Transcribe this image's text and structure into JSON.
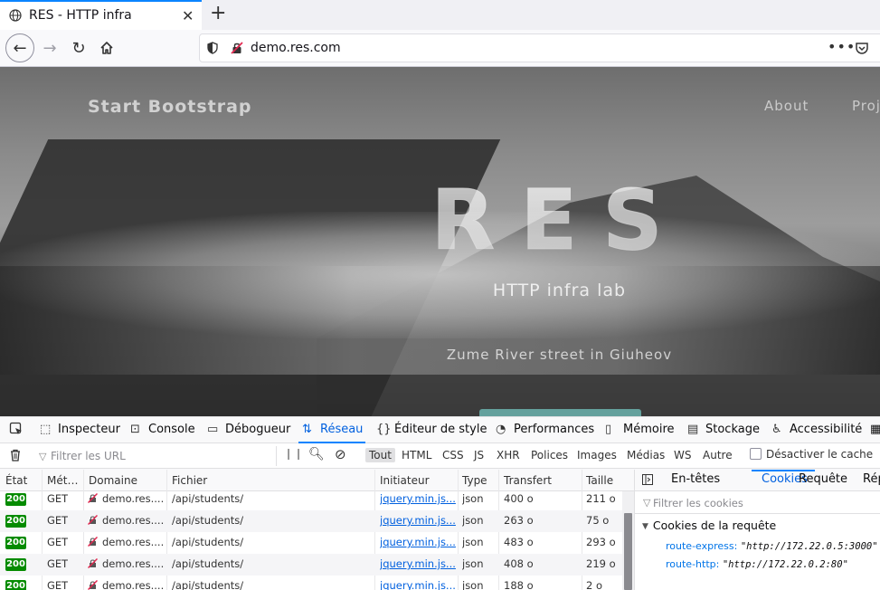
{
  "browser": {
    "tab_title": "RES - HTTP infra",
    "url": "demo.res.com"
  },
  "page": {
    "brand": "Start Bootstrap",
    "nav": [
      "About",
      "Proj"
    ],
    "title": "RES",
    "subtitle": "HTTP infra lab",
    "address": "Zume River street in Giuheov"
  },
  "devtools": {
    "tabs": [
      "Inspecteur",
      "Console",
      "Débogueur",
      "Réseau",
      "Éditeur de style",
      "Performances",
      "Mémoire",
      "Stockage",
      "Accessibilité"
    ],
    "active_tab": "Réseau",
    "filter_placeholder": "Filtrer les URL",
    "filter_types": [
      "Tout",
      "HTML",
      "CSS",
      "JS",
      "XHR",
      "Polices",
      "Images",
      "Médias",
      "WS",
      "Autre"
    ],
    "selected_filter": "Tout",
    "disable_cache_label": "Désactiver le cache",
    "columns": [
      "État",
      "Mét…",
      "Domaine",
      "Fichier",
      "Initiateur",
      "Type",
      "Transfert",
      "Taille"
    ],
    "requests": [
      {
        "status": "200",
        "method": "GET",
        "domain": "demo.res....",
        "file": "/api/students/",
        "initiator": "jquery.min.js...",
        "type": "json",
        "transfer": "400 o",
        "size": "211 o"
      },
      {
        "status": "200",
        "method": "GET",
        "domain": "demo.res....",
        "file": "/api/students/",
        "initiator": "jquery.min.js...",
        "type": "json",
        "transfer": "263 o",
        "size": "75 o"
      },
      {
        "status": "200",
        "method": "GET",
        "domain": "demo.res....",
        "file": "/api/students/",
        "initiator": "jquery.min.js...",
        "type": "json",
        "transfer": "483 o",
        "size": "293 o"
      },
      {
        "status": "200",
        "method": "GET",
        "domain": "demo.res....",
        "file": "/api/students/",
        "initiator": "jquery.min.js...",
        "type": "json",
        "transfer": "408 o",
        "size": "219 o"
      },
      {
        "status": "200",
        "method": "GET",
        "domain": "demo.res....",
        "file": "/api/students/",
        "initiator": "jquery.min.js...",
        "type": "json",
        "transfer": "188 o",
        "size": "2 o"
      }
    ],
    "side_tabs": [
      "En-têtes",
      "Cookies",
      "Requête",
      "Rép"
    ],
    "active_side_tab": "Cookies",
    "cookie_filter_placeholder": "Filtrer les cookies",
    "cookie_section_title": "Cookies de la requête",
    "cookies": [
      {
        "name": "route-express:",
        "value": "\"http://172.22.0.5:3000\""
      },
      {
        "name": "route-http:",
        "value": "\"http://172.22.0.2:80\""
      }
    ]
  },
  "colors": {
    "accent": "#0a84ff",
    "status_ok": "#058b00",
    "link": "#0060df"
  }
}
